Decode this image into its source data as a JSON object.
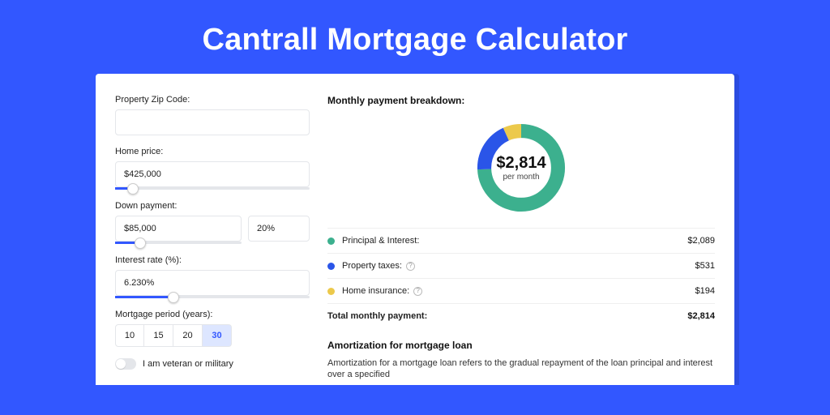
{
  "title": "Cantrall Mortgage Calculator",
  "form": {
    "zip": {
      "label": "Property Zip Code:",
      "value": ""
    },
    "price": {
      "label": "Home price:",
      "value": "$425,000",
      "slider_pct": 9
    },
    "down": {
      "label": "Down payment:",
      "value": "$85,000",
      "pct_value": "20%",
      "slider_pct": 20
    },
    "rate": {
      "label": "Interest rate (%):",
      "value": "6.230%",
      "slider_pct": 30
    },
    "period": {
      "label": "Mortgage period (years):",
      "options": [
        "10",
        "15",
        "20",
        "30"
      ],
      "selected": "30"
    },
    "veteran": {
      "label": "I am veteran or military",
      "on": false
    }
  },
  "breakdown": {
    "title": "Monthly payment breakdown:",
    "center_value": "$2,814",
    "center_sub": "per month",
    "items": [
      {
        "label": "Principal & Interest:",
        "value": "$2,089",
        "color": "#3cb08e",
        "help": false
      },
      {
        "label": "Property taxes:",
        "value": "$531",
        "color": "#2a55e8",
        "help": true
      },
      {
        "label": "Home insurance:",
        "value": "$194",
        "color": "#ecc94b",
        "help": true
      }
    ],
    "total": {
      "label": "Total monthly payment:",
      "value": "$2,814"
    }
  },
  "chart_data": {
    "type": "pie",
    "title": "Monthly payment breakdown",
    "series": [
      {
        "name": "Principal & Interest",
        "value": 2089,
        "color": "#3cb08e"
      },
      {
        "name": "Property taxes",
        "value": 531,
        "color": "#2a55e8"
      },
      {
        "name": "Home insurance",
        "value": 194,
        "color": "#ecc94b"
      }
    ],
    "center_value": 2814,
    "center_unit": "per month"
  },
  "amortization": {
    "title": "Amortization for mortgage loan",
    "body": "Amortization for a mortgage loan refers to the gradual repayment of the loan principal and interest over a specified"
  }
}
